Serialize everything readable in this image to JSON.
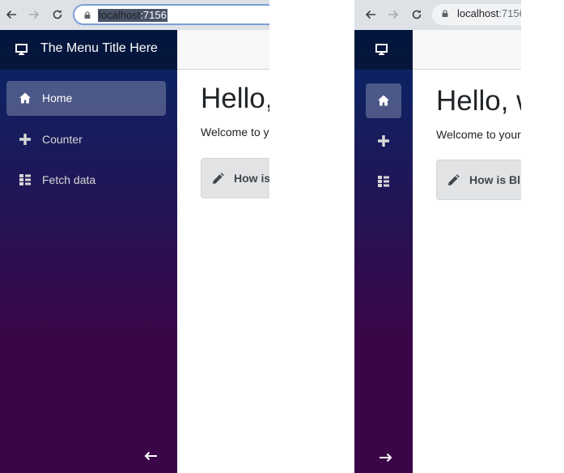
{
  "expanded_view": {
    "browser": {
      "url_host": "localhost",
      "url_port": ":7156",
      "back_icon": "arrow-left-icon",
      "forward_icon": "arrow-right-icon",
      "reload_icon": "reload-icon",
      "lock_icon": "lock-icon"
    },
    "sidebar": {
      "brand_title": "The Menu Title Here",
      "brand_icon": "monitor-icon",
      "items": [
        {
          "label": "Home",
          "icon": "home-icon",
          "active": true
        },
        {
          "label": "Counter",
          "icon": "plus-icon",
          "active": false
        },
        {
          "label": "Fetch data",
          "icon": "list-icon",
          "active": false
        }
      ],
      "collapse_icon": "arrow-left-icon"
    },
    "main": {
      "heading": "Hello,",
      "welcome": "Welcome to yo",
      "alert_text": "How is",
      "alert_icon": "pencil-icon"
    }
  },
  "collapsed_view": {
    "browser": {
      "url_host": "localhost",
      "url_port": ":7156"
    },
    "sidebar": {
      "brand_icon": "monitor-icon",
      "items": [
        {
          "icon": "home-icon",
          "active": true
        },
        {
          "icon": "plus-icon",
          "active": false
        },
        {
          "icon": "list-icon",
          "active": false
        }
      ],
      "expand_icon": "arrow-right-icon"
    },
    "main": {
      "heading": "Hello, w",
      "welcome": "Welcome to your",
      "alert_text": "How is Bl",
      "alert_icon": "pencil-icon"
    }
  },
  "colors": {
    "sidebar_top": "#052767",
    "sidebar_bottom": "#3a0647",
    "active_item": "rgba(255,255,255,0.25)",
    "alert_bg": "#e2e3e5"
  }
}
